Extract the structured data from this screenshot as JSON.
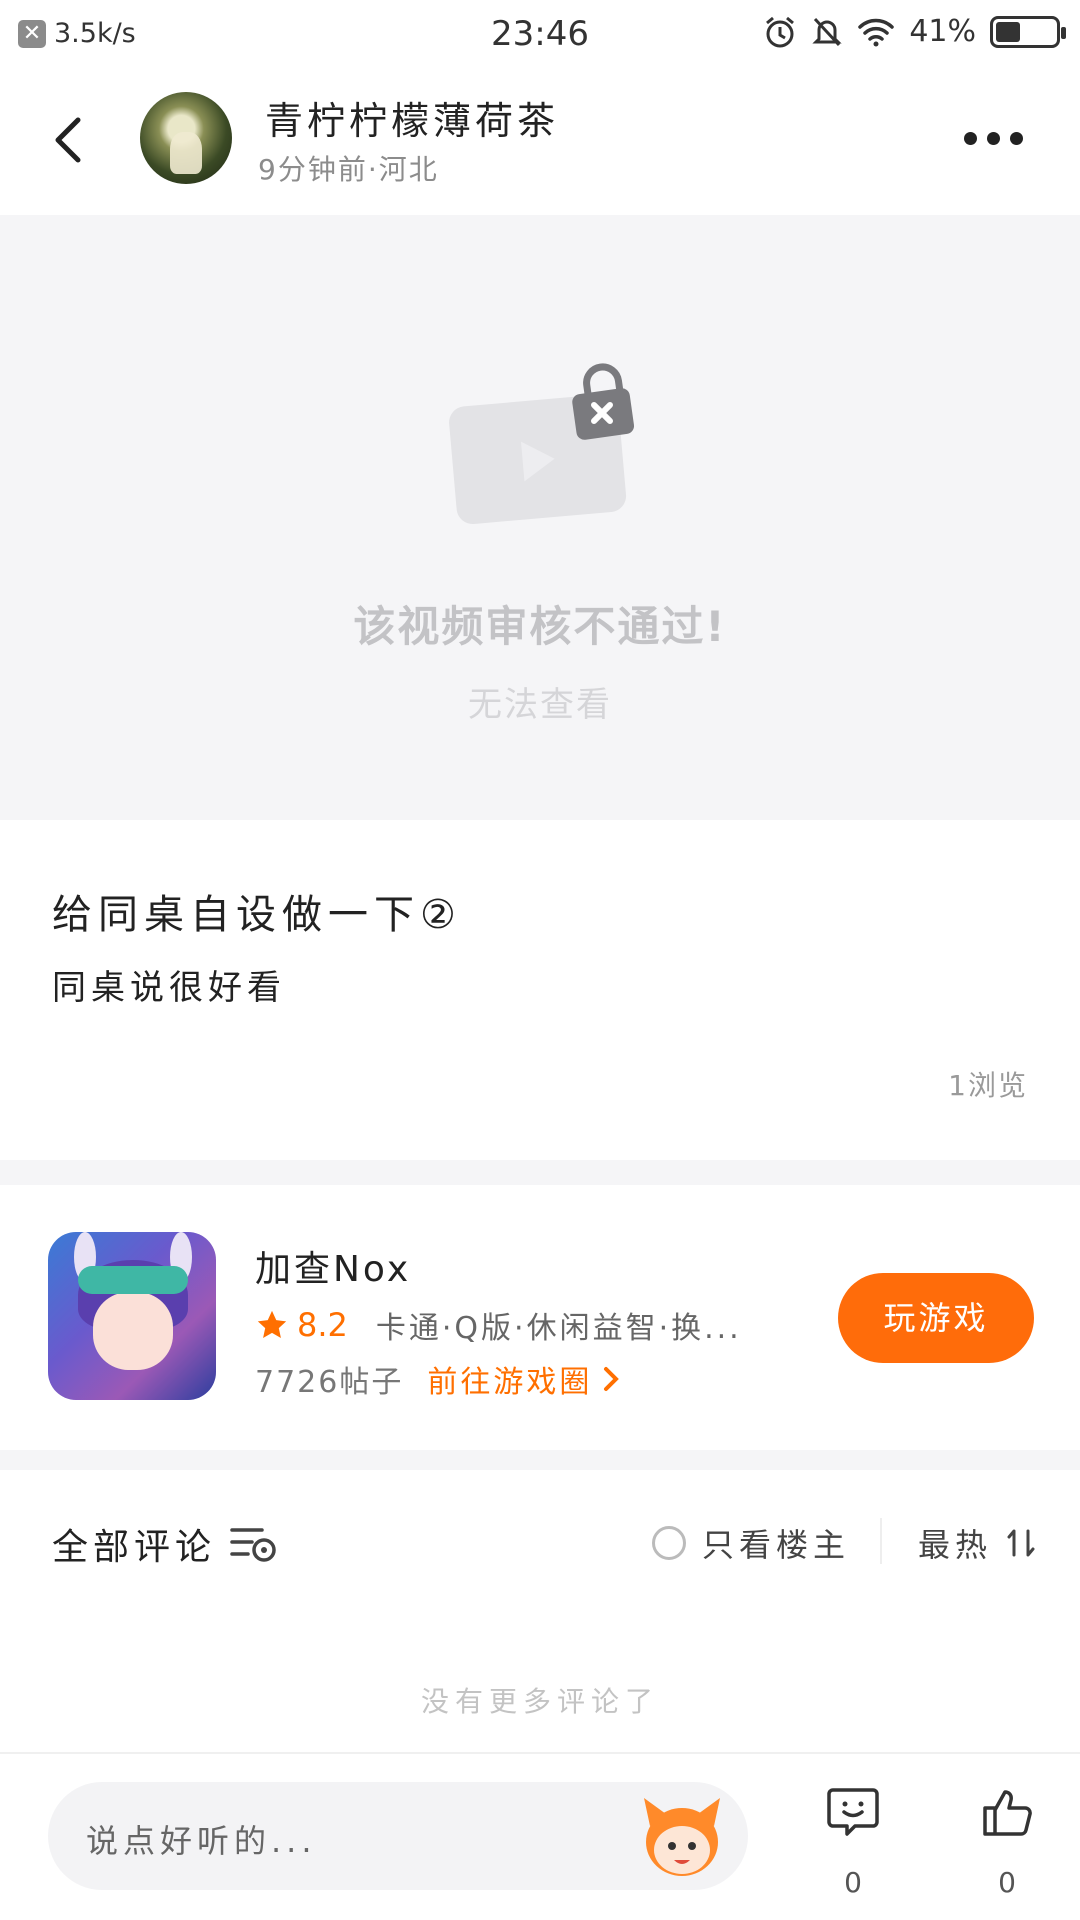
{
  "status_bar": {
    "net_speed": "3.5k/s",
    "time": "23:46",
    "battery_text": "41%",
    "battery_level": 0.41
  },
  "header": {
    "user_name": "青柠柠檬薄荷茶",
    "meta": "9分钟前·河北"
  },
  "video": {
    "blocked_title": "该视频审核不通过!",
    "blocked_subtitle": "无法查看"
  },
  "post": {
    "title": "给同桌自设做一下②",
    "body": "同桌说很好看",
    "views": "1浏览"
  },
  "game": {
    "name": "加查Nox",
    "score": "8.2",
    "tags": "卡通·Q版·休闲益智·换...",
    "posts": "7726帖子",
    "circle_link": "前往游戏圈",
    "play_button": "玩游戏"
  },
  "comments": {
    "title": "全部评论",
    "only_owner": "只看楼主",
    "sort": "最热",
    "empty_text": "没有更多评论了"
  },
  "bottom_bar": {
    "input_placeholder": "说点好听的...",
    "comment_count": "0",
    "like_count": "0"
  },
  "colors": {
    "accent": "#ff6c0a",
    "background_gray": "#f5f5f7"
  }
}
